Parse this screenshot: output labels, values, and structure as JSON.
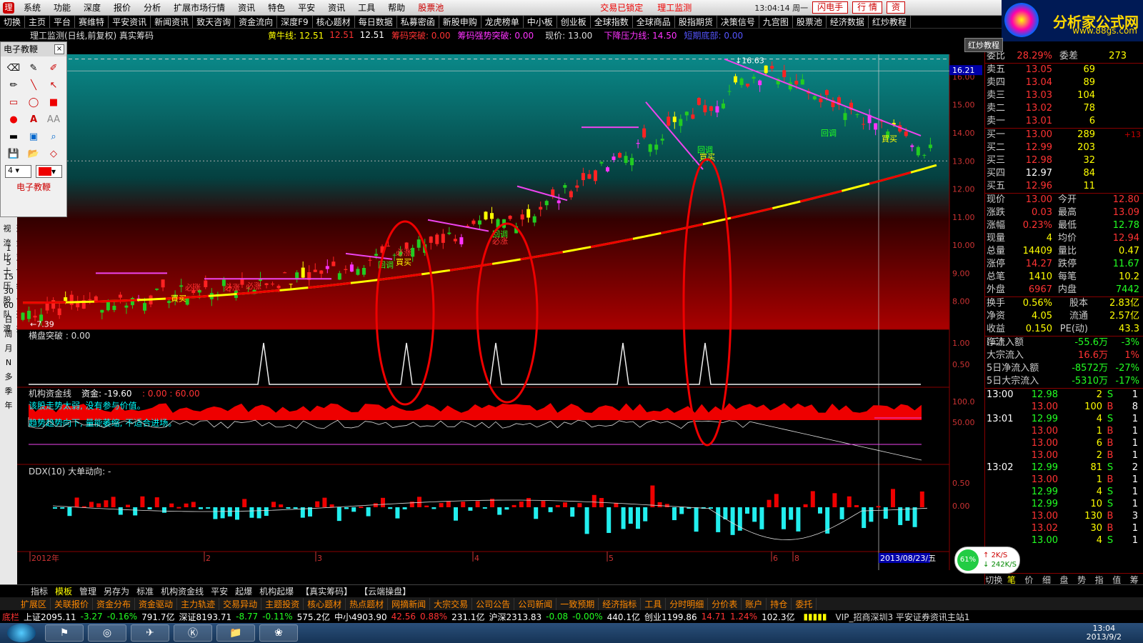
{
  "menubar": {
    "items": [
      "系统",
      "功能",
      "深度",
      "报价",
      "分析",
      "扩展市场行情",
      "资讯",
      "特色",
      "平安",
      "资讯",
      "工具",
      "帮助"
    ],
    "pool": "股票池",
    "notice_a": "交易已锁定",
    "notice_b": "理工监测",
    "clock": "13:04:14 周一",
    "btn_flash": "闪电手",
    "btn_quote": "行 情",
    "btn_asset": "资"
  },
  "toolbar": {
    "items": [
      "切换",
      "主页",
      "平台",
      "赛维特",
      "平安资讯",
      "新闻资讯",
      "致天咨询",
      "资金流向",
      "深度F9",
      "核心题材",
      "每日数据",
      "私募密函",
      "新股申购",
      "龙虎榜单",
      "中小板",
      "创业板",
      "全球指数",
      "全球商品",
      "股指期货",
      "决策信号",
      "九宫图",
      "股票池",
      "经济数据",
      "红炒教程"
    ]
  },
  "logo": {
    "main": "分析家公式网",
    "url": "www.88gs.com"
  },
  "hongbang": "红炒教程",
  "infobar": {
    "title": "理工监测(日线,前复权) 真实筹码",
    "huangniu": "黄牛线: 12.51",
    "v2": "12.51",
    "v3": "12.51",
    "chouma": "筹码突破: 0.00",
    "chouma2": "筹码强势突破: 0.00",
    "price": "现价: 13.00",
    "pressure": "下降压力线: 14.50",
    "bottom": "短期底部: 0.00"
  },
  "drawpanel": {
    "title": "电子教鞭",
    "close": "×",
    "width_val": "4",
    "footer": "电子教鞭"
  },
  "left_axis": [
    "财务透视",
    "资金流",
    "主力对比",
    "翻博士",
    "龙线压",
    "牛叉诊股",
    "敢死队",
    "摆渡"
  ],
  "left_periods": [
    "1",
    "5",
    "15",
    "30",
    "60",
    "日",
    "周",
    "月",
    "N",
    "多",
    "季",
    "年"
  ],
  "panels": {
    "main_yticks": [
      "16.00",
      "15.00",
      "14.00",
      "13.00",
      "12.00",
      "11.00",
      "10.00",
      "9.00",
      "8.00"
    ],
    "price_high": "16.63",
    "price_high_box": "16.21",
    "price_low": "7.39",
    "p2_title": "横盘突破 : 0.00",
    "p2_yticks": [
      "1.00",
      "0.50"
    ],
    "p3_title": "机构资金线",
    "p3_val": "资金: -19.60",
    "p3_range": ": 0.00 : 60.00",
    "p3_text1": "该股走势太弱, 没有参与价值。",
    "p3_text2": "趋势趋势向下, 量能萎缩, 不适合进场。",
    "p3_yticks": [
      "100.0",
      "50.00"
    ],
    "p4_title": "DDX(10) 大单动向: -",
    "p4_yticks": [
      "0.50",
      "0.00"
    ],
    "xlabels": [
      "2012年",
      "2",
      "3",
      "4",
      "5",
      "6",
      "8"
    ],
    "xdate": "2013/08/23/五",
    "annotations": {
      "buy": "買买",
      "hui": "回调",
      "bizhang": "必涨"
    }
  },
  "right": {
    "weibi_label": "委比",
    "weibi": "28.29%",
    "weicha_label": "委差",
    "weicha": "273",
    "asks": [
      {
        "l": "卖五",
        "p": "13.05",
        "q": "69"
      },
      {
        "l": "卖四",
        "p": "13.04",
        "q": "89"
      },
      {
        "l": "卖三",
        "p": "13.03",
        "q": "104"
      },
      {
        "l": "卖二",
        "p": "13.02",
        "q": "78"
      },
      {
        "l": "卖一",
        "p": "13.01",
        "q": "6"
      }
    ],
    "bids": [
      {
        "l": "买一",
        "p": "13.00",
        "q": "289",
        "x": "+13"
      },
      {
        "l": "买二",
        "p": "12.99",
        "q": "203",
        "x": ""
      },
      {
        "l": "买三",
        "p": "12.98",
        "q": "32",
        "x": ""
      },
      {
        "l": "买四",
        "p": "12.97",
        "q": "84",
        "x": ""
      },
      {
        "l": "买五",
        "p": "12.96",
        "q": "11",
        "x": ""
      }
    ],
    "stats": [
      {
        "a": "现价",
        "b": "13.00",
        "bc": "up",
        "c": "今开",
        "d": "12.80",
        "dc": "up"
      },
      {
        "a": "涨跌",
        "b": "0.03",
        "bc": "up",
        "c": "最高",
        "d": "13.09",
        "dc": "up"
      },
      {
        "a": "涨幅",
        "b": "0.23%",
        "bc": "up",
        "c": "最低",
        "d": "12.78",
        "dc": "dn"
      },
      {
        "a": "现量",
        "b": "4",
        "bc": "yl",
        "c": "均价",
        "d": "12.94",
        "dc": "up"
      },
      {
        "a": "总量",
        "b": "14409",
        "bc": "yl",
        "c": "量比",
        "d": "0.47",
        "dc": "yl"
      },
      {
        "a": "涨停",
        "b": "14.27",
        "bc": "up",
        "c": "跌停",
        "d": "11.67",
        "dc": "dn"
      },
      {
        "a": "总笔",
        "b": "1410",
        "bc": "yl",
        "c": "每笔",
        "d": "10.2",
        "dc": "yl"
      },
      {
        "a": "外盘",
        "b": "6967",
        "bc": "up",
        "c": "内盘",
        "d": "7442",
        "dc": "dn"
      }
    ],
    "stats2": [
      {
        "a": "换手",
        "b": "0.56%",
        "c": "股本",
        "d": "2.83亿"
      },
      {
        "a": "净资",
        "b": "4.05",
        "c": "流通",
        "d": "2.57亿"
      },
      {
        "a": "收益(二)",
        "b": "0.150",
        "c": "PE(动)",
        "d": "43.3"
      }
    ],
    "flows": [
      {
        "a": "净流入额",
        "b": "-55.6万",
        "c": "-3%",
        "cls": "dn"
      },
      {
        "a": "大宗流入",
        "b": "16.6万",
        "c": "1%",
        "cls": "up"
      },
      {
        "a": "5日净流入额",
        "b": "-8572万",
        "c": "-27%",
        "cls": "dn"
      },
      {
        "a": "5日大宗流入",
        "b": "-5310万",
        "c": "-17%",
        "cls": "dn"
      }
    ],
    "ticks": [
      {
        "t": "13:00",
        "p": "12.98",
        "q": "2",
        "s": "S",
        "c": "1"
      },
      {
        "t": "",
        "p": "13.00",
        "q": "100",
        "s": "B",
        "c": "8"
      },
      {
        "t": "13:01",
        "p": "12.99",
        "q": "4",
        "s": "S",
        "c": "1"
      },
      {
        "t": "",
        "p": "13.00",
        "q": "1",
        "s": "B",
        "c": "1"
      },
      {
        "t": "",
        "p": "13.00",
        "q": "6",
        "s": "B",
        "c": "1"
      },
      {
        "t": "",
        "p": "13.00",
        "q": "2",
        "s": "B",
        "c": "1"
      },
      {
        "t": "13:02",
        "p": "12.99",
        "q": "81",
        "s": "S",
        "c": "2"
      },
      {
        "t": "",
        "p": "13.00",
        "q": "1",
        "s": "B",
        "c": "1"
      },
      {
        "t": "",
        "p": "12.99",
        "q": "4",
        "s": "S",
        "c": "1"
      },
      {
        "t": "",
        "p": "12.99",
        "q": "10",
        "s": "S",
        "c": "1"
      },
      {
        "t": "",
        "p": "13.00",
        "q": "130",
        "s": "B",
        "c": "3"
      },
      {
        "t": "",
        "p": "13.02",
        "q": "30",
        "s": "B",
        "c": "1"
      },
      {
        "t": "",
        "p": "13.00",
        "q": "4",
        "s": "S",
        "c": "1"
      }
    ],
    "tabs": [
      "切换",
      "笔",
      "价",
      "细",
      "盘",
      "势",
      "指",
      "值",
      "筹"
    ]
  },
  "traybadge": {
    "pct": "61%",
    "up": "2K/S",
    "down": "242K/S"
  },
  "bottomtabs": [
    "指标",
    "模板",
    "管理",
    "另存为",
    "标准",
    "机构资金线",
    "平安",
    "起爆",
    "机构起爆",
    "【真实筹码】",
    "【云端操盘】"
  ],
  "functabs": [
    "扩展区",
    "关联报价",
    "资金分布",
    "资金驱动",
    "主力轨迹",
    "交易异动",
    "主题投资",
    "核心题材",
    "热点题材",
    "网摘新闻",
    "大宗交易",
    "公司公告",
    "公司新闻",
    "一致预期",
    "经济指标",
    "工具",
    "分时明细",
    "分价表",
    "账户",
    "持仓",
    "委托"
  ],
  "indexbar": {
    "label": "底栏",
    "sh": "上证2095.11",
    "sh_c": "-3.27",
    "sh_p": "-0.16%",
    "sh_v": "791.7亿",
    "sz": "深证8193.71",
    "sz_c": "-8.77",
    "sz_p": "-0.11%",
    "sz_v": "575.2亿",
    "zx": "中小4903.90",
    "zx_c": "42.56",
    "zx_p": "0.88%",
    "zx_v": "231.1亿",
    "hs": "沪深2313.83",
    "hs_c": "-0.08",
    "hs_p": "-0.00%",
    "hs_v": "440.1亿",
    "cy": "创业1199.86",
    "cy_c": "14.71",
    "cy_p": "1.24%",
    "cy_v": "102.3亿",
    "server": "VIP_招商深圳3 平安证券资讯主站1"
  },
  "taskbar": {
    "time": "13:04",
    "date": "2013/9/2"
  },
  "colors": {
    "up": "#ff3333",
    "down": "#33ff33",
    "ma": "#ffff00",
    "pressure": "#ee44ee"
  }
}
